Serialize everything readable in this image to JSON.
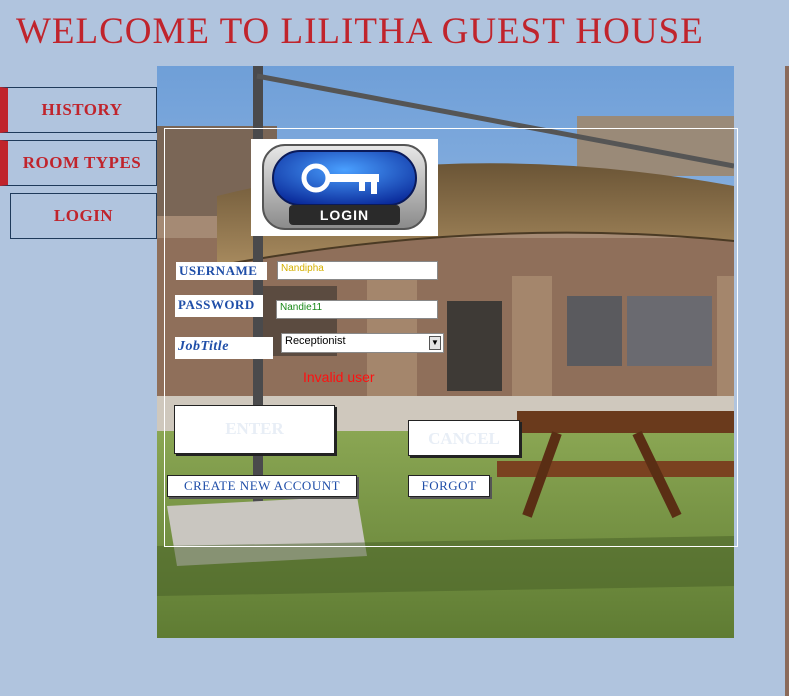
{
  "window_title": "WELCOME TO LILITHA GUEST HOUSE",
  "sidebar": {
    "items": [
      {
        "label": "HISTORY"
      },
      {
        "label": "ROOM TYPES"
      },
      {
        "label": "LOGIN"
      }
    ]
  },
  "login_form": {
    "logo_text": "LOGIN",
    "logo_icon": "key-icon",
    "username_label": "USERNAME",
    "username_value": "Nandipha",
    "password_label": "PASSWORD",
    "password_value": "Nandie11",
    "jobtitle_label": "JobTitle",
    "jobtitle_selected": "Receptionist",
    "error_message": "Invalid user",
    "enter_label": "ENTER",
    "cancel_label": "CANCEL",
    "create_account_label": "CREATE NEW ACCOUNT",
    "forgot_label": "FORGOT"
  },
  "colors": {
    "background": "#b0c4de",
    "title": "#c0242c",
    "label_text": "#1f4ea8",
    "error": "#ff1010"
  }
}
